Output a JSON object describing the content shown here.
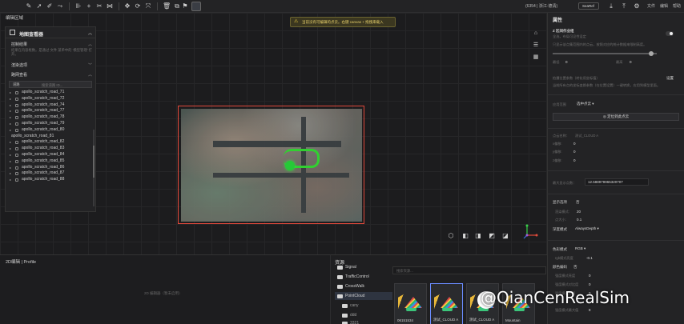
{
  "toolbar": {
    "right_status": "(6354 | 浙江·德清)",
    "chip_label": "SeaRef",
    "menu": [
      "文件",
      "编辑",
      "帮助"
    ]
  },
  "viewport": {
    "title": "编辑区域",
    "warning": "当前没有可编辑的点云。右键 canvas + 拖拽来载入"
  },
  "map_panel": {
    "title": "地图查看器",
    "sections": [
      {
        "label": "控制结果",
        "desc": "结果在内容框数。是通过 文件 菜单中的 '模型管理' 打开。"
      },
      {
        "label": "渲染选项"
      },
      {
        "label": "路网查看"
      }
    ],
    "road_search": {
      "label": "道路",
      "placeholder": "搜索道路 ID..."
    },
    "roads": [
      "apollo_scratch_road_71",
      "apollo_scratch_road_72",
      "apollo_scratch_road_74",
      "apollo_scratch_road_77",
      "apollo_scratch_road_78",
      "apollo_scratch_road_79",
      "apollo_scratch_road_80",
      "apollo_scratch_road_81",
      "apollo_scratch_road_82",
      "apollo_scratch_road_83",
      "apollo_scratch_road_84",
      "apollo_scratch_road_85",
      "apollo_scratch_road_86",
      "apollo_scratch_road_87",
      "apollo_scratch_road_88"
    ]
  },
  "bottom2d": {
    "title": "2D编辑 | Profile",
    "message": "2D 编辑器（暂未启用）"
  },
  "resources": {
    "title": "资源",
    "folders": [
      "Signal",
      "TrafficControl",
      "CrossWalk",
      "PointCloud"
    ],
    "subfolders": [
      "cany",
      "ddd",
      "3321"
    ],
    "search_placeholder": "搜索资源...",
    "thumbs": [
      "06151534",
      "测试_CLOUD A",
      "测试_CLOUD A",
      "Mountain"
    ]
  },
  "properties": {
    "title": "属性",
    "z_section": "Z 区间作业组",
    "z_desc1": "全选，布局可见性设定",
    "z_desc2": "只显示该点集范围内的点云，按照对应的统计数据来限制高度。",
    "min_label": "最低",
    "min_value": "0",
    "max_label": "最高",
    "max_value": "0",
    "pos_label": "拍摄位置参数（转化用坐标值）",
    "pos_link": "设置",
    "pos_desc": "当前所有点的坐标变换参数（在位置设置）一键转换，应用到模型里面。",
    "apply_label": "应用范围",
    "apply_value": "选中点云",
    "locate_button": "定位到此点云",
    "cloud_name_label": "点云名称：",
    "cloud_name_value": "测试_CLOUD A",
    "x_label": "x偏移:",
    "x_value": "0",
    "y_label": "y偏移:",
    "y_value": "0",
    "z_label": "z偏移:",
    "z_value": "0",
    "max_dist_label": "最大显示点数：",
    "max_dist_value": "12.588979965320707",
    "display_section": "显示选项",
    "display_value": "否",
    "pt_size_label": "渲染模式:",
    "pt_size_value": "20",
    "pt_scale_label": "点大小:",
    "pt_scale_value": "0.1",
    "depth_label": "深度模式",
    "depth_value": "AlwaysDepth",
    "color_mode_label": "色彩模式",
    "color_mode_value": "RGB",
    "gamma_label": "rgb模式亮度",
    "gamma_value": "-0.1",
    "color_code_label": "颜色编码",
    "color_code_value": "否",
    "f1_label": "强度模式亮度",
    "f1_value": "0",
    "f2_label": "强度模式对比度",
    "f2_value": "0",
    "f3_label": "强度模式范围",
    "f3_value": "0",
    "f4_label": "强度模式最大值",
    "f4_value": "8"
  },
  "watermark": "@QianCenRealSim"
}
